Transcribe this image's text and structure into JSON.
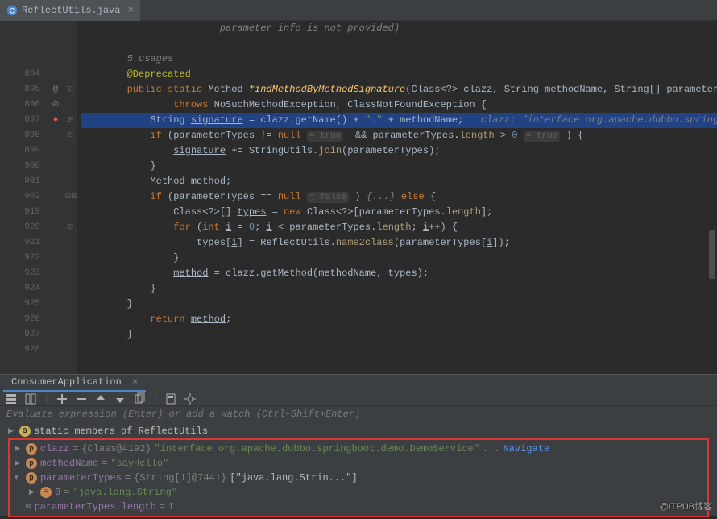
{
  "editor": {
    "tab": {
      "filename": "ReflectUtils.java"
    },
    "lines": [
      {
        "n": "",
        "icons": "",
        "fold": "",
        "segs": [
          [
            "plain",
            "                        "
          ],
          [
            "faded-italic",
            "parameter info is not provided)"
          ]
        ]
      },
      {
        "n": "",
        "icons": "",
        "fold": "",
        "segs": [
          [
            "plain",
            "                "
          ]
        ]
      },
      {
        "n": "",
        "icons": "",
        "fold": "",
        "segs": [
          [
            "comment",
            "        5 usages"
          ]
        ]
      },
      {
        "n": "894",
        "icons": "",
        "fold": "",
        "segs": [
          [
            "plain",
            "        "
          ],
          [
            "anno",
            "@Deprecated"
          ]
        ]
      },
      {
        "n": "895",
        "icons": "@",
        "fold": "⊟",
        "segs": [
          [
            "plain",
            "        "
          ],
          [
            "kw",
            "public static "
          ],
          [
            "ty",
            "Method "
          ],
          [
            "mname",
            "findMethodByMethodSignature"
          ],
          [
            "plain",
            "(Class<?> clazz, String methodName, String[] parameterTypes)"
          ]
        ]
      },
      {
        "n": "896",
        "icons": "⊘",
        "fold": "",
        "segs": [
          [
            "plain",
            "                "
          ],
          [
            "kw",
            "throws "
          ],
          [
            "ty",
            "NoSuchMethodException"
          ],
          [
            "plain",
            ", "
          ],
          [
            "ty",
            "ClassNotFoundException"
          ],
          [
            "plain",
            " {"
          ]
        ]
      },
      {
        "n": "897",
        "icons": "●",
        "fold": "⊟",
        "hl": true,
        "segs": [
          [
            "plain",
            "            String "
          ],
          [
            "under",
            "signature"
          ],
          [
            "plain",
            " = clazz.getName() + "
          ],
          [
            "str",
            "\".\""
          ],
          [
            "plain",
            " + methodName;   "
          ],
          [
            "faded-italic",
            "clazz: \"interface org.apache.dubbo.springboot.dem"
          ]
        ]
      },
      {
        "n": "898",
        "icons": "",
        "fold": "⊟",
        "segs": [
          [
            "plain",
            "            "
          ],
          [
            "kw",
            "if"
          ],
          [
            "plain",
            " (parameterTypes != "
          ],
          [
            "kw",
            "null"
          ],
          [
            "plain",
            " "
          ],
          [
            "hint",
            "= true"
          ],
          [
            "plain",
            "  && parameterTypes."
          ],
          [
            "mcall",
            "length"
          ],
          [
            "plain",
            " > "
          ],
          [
            "num",
            "0"
          ],
          [
            "plain",
            " "
          ],
          [
            "hint",
            "= true"
          ],
          [
            "plain",
            " ) {"
          ]
        ]
      },
      {
        "n": "899",
        "icons": "",
        "fold": "",
        "segs": [
          [
            "plain",
            "                "
          ],
          [
            "under",
            "signature"
          ],
          [
            "plain",
            " += StringUtils."
          ],
          [
            "mcall",
            "join"
          ],
          [
            "plain",
            "(parameterTypes);"
          ]
        ]
      },
      {
        "n": "900",
        "icons": "",
        "fold": "",
        "segs": [
          [
            "plain",
            "            }"
          ]
        ]
      },
      {
        "n": "901",
        "icons": "",
        "fold": "",
        "segs": [
          [
            "plain",
            "            Method "
          ],
          [
            "under",
            "method"
          ],
          [
            "plain",
            ";"
          ]
        ]
      },
      {
        "n": "902",
        "icons": "",
        "fold": "⊟⊞",
        "segs": [
          [
            "plain",
            "            "
          ],
          [
            "kw",
            "if"
          ],
          [
            "plain",
            " (parameterTypes == "
          ],
          [
            "kw",
            "null"
          ],
          [
            "plain",
            " "
          ],
          [
            "hint",
            "= false"
          ],
          [
            "plain",
            " ) "
          ],
          [
            "faded-italic",
            "{...}"
          ],
          [
            "plain",
            " "
          ],
          [
            "kw",
            "else"
          ],
          [
            "plain",
            " {"
          ]
        ]
      },
      {
        "n": "919",
        "icons": "",
        "fold": "",
        "segs": [
          [
            "plain",
            "                Class<?>[] "
          ],
          [
            "under",
            "types"
          ],
          [
            "plain",
            " = "
          ],
          [
            "kw",
            "new"
          ],
          [
            "plain",
            " Class<?>[parameterTypes."
          ],
          [
            "mcall",
            "length"
          ],
          [
            "plain",
            "];"
          ]
        ]
      },
      {
        "n": "920",
        "icons": "",
        "fold": "⊟",
        "segs": [
          [
            "plain",
            "                "
          ],
          [
            "kw",
            "for"
          ],
          [
            "plain",
            " ("
          ],
          [
            "kw",
            "int"
          ],
          [
            "plain",
            " "
          ],
          [
            "under",
            "i"
          ],
          [
            "plain",
            " = "
          ],
          [
            "num",
            "0"
          ],
          [
            "plain",
            "; "
          ],
          [
            "under",
            "i"
          ],
          [
            "plain",
            " < parameterTypes."
          ],
          [
            "mcall",
            "length"
          ],
          [
            "plain",
            "; "
          ],
          [
            "under",
            "i"
          ],
          [
            "plain",
            "++) {"
          ]
        ]
      },
      {
        "n": "921",
        "icons": "",
        "fold": "",
        "segs": [
          [
            "plain",
            "                    types["
          ],
          [
            "under",
            "i"
          ],
          [
            "plain",
            "] = ReflectUtils."
          ],
          [
            "mcall",
            "name2class"
          ],
          [
            "plain",
            "(parameterTypes["
          ],
          [
            "under",
            "i"
          ],
          [
            "plain",
            "]);"
          ]
        ]
      },
      {
        "n": "922",
        "icons": "",
        "fold": "",
        "segs": [
          [
            "plain",
            "                }"
          ]
        ]
      },
      {
        "n": "923",
        "icons": "",
        "fold": "",
        "segs": [
          [
            "plain",
            "                "
          ],
          [
            "under",
            "method"
          ],
          [
            "plain",
            " = clazz.getMethod(methodName, types);"
          ]
        ]
      },
      {
        "n": "924",
        "icons": "",
        "fold": "",
        "segs": [
          [
            "plain",
            "            }"
          ]
        ]
      },
      {
        "n": "925",
        "icons": "",
        "fold": "",
        "segs": [
          [
            "plain",
            "        }"
          ]
        ]
      },
      {
        "n": "926",
        "icons": "",
        "fold": "",
        "segs": [
          [
            "plain",
            "            "
          ],
          [
            "kw",
            "return"
          ],
          [
            "plain",
            " "
          ],
          [
            "under",
            "method"
          ],
          [
            "plain",
            ";"
          ]
        ]
      },
      {
        "n": "927",
        "icons": "",
        "fold": "",
        "segs": [
          [
            "plain",
            "        }"
          ]
        ]
      },
      {
        "n": "928",
        "icons": "",
        "fold": "",
        "segs": [
          [
            "plain",
            ""
          ]
        ]
      }
    ]
  },
  "debug": {
    "tab": "ConsumerApplication",
    "eval_hint": "Evaluate expression (Enter) or add a watch (Ctrl+Shift+Enter)",
    "vars": {
      "static_members": "static members of ReflectUtils",
      "clazz_name": "clazz",
      "clazz_eq": " = ",
      "clazz_type": "{Class@4192} ",
      "clazz_val": "\"interface org.apache.dubbo.springboot.demo.DemoService\"",
      "clazz_ell": " ... ",
      "navigate": "Navigate",
      "method_name": "methodName",
      "method_eq": " = ",
      "method_val": "\"sayHello\"",
      "pt_name": "parameterTypes",
      "pt_eq": " = ",
      "pt_type": "{String[1]@7441} ",
      "pt_val": "[\"java.lang.Strin...\"]",
      "pt0_name": "0",
      "pt0_eq": " = ",
      "pt0_val": "\"java.lang.String\"",
      "ptlen_name": "parameterTypes.length",
      "ptlen_eq": " = ",
      "ptlen_val": "1"
    }
  },
  "watermark": "@ITPUB博客"
}
